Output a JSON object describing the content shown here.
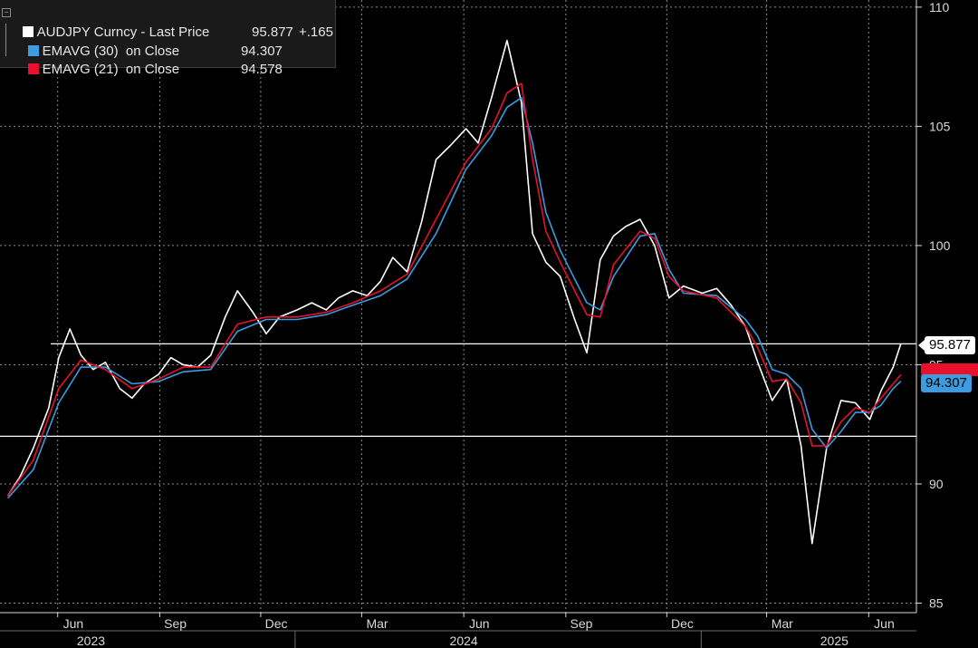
{
  "legend": {
    "row1": {
      "name": "AUDJPY Curncy - Last Price",
      "value": "95.877",
      "change": "+.165",
      "color": "#ffffff"
    },
    "row2": {
      "name": "EMAVG (30)  on Close",
      "value": "94.307",
      "color": "#3d9be0"
    },
    "row3": {
      "name": "EMAVG (21)  on Close",
      "value": "94.578",
      "color": "#e8102a"
    }
  },
  "tags": {
    "last": "95.877",
    "ema30": "94.307"
  },
  "chart_data": {
    "type": "line",
    "title": "",
    "xlabel": "",
    "ylabel": "",
    "ylim": [
      84.6,
      110.3
    ],
    "yticks": [
      85,
      90,
      95,
      100,
      105,
      110
    ],
    "month_ticks": [
      {
        "label": "Jun",
        "month": "2023-06"
      },
      {
        "label": "Sep",
        "month": "2023-09"
      },
      {
        "label": "Dec",
        "month": "2023-12"
      },
      {
        "label": "Mar",
        "month": "2024-03"
      },
      {
        "label": "Jun",
        "month": "2024-06"
      },
      {
        "label": "Sep",
        "month": "2024-09"
      },
      {
        "label": "Dec",
        "month": "2024-12"
      },
      {
        "label": "Mar",
        "month": "2025-03"
      },
      {
        "label": "Jun",
        "month": "2025-06"
      }
    ],
    "year_labels": [
      {
        "label": "2023",
        "month": "2023-07"
      },
      {
        "label": "2024",
        "month": "2024-06"
      },
      {
        "label": "2025",
        "month": "2025-05"
      }
    ],
    "horizontal_lines": [
      95.877,
      92.0
    ],
    "colors": {
      "price": "#ffffff",
      "ema30": "#3d9be0",
      "ema21": "#e8102a",
      "grid": "#8c8c8c",
      "background": "#000000"
    },
    "series": [
      {
        "key": "price",
        "name": "AUDJPY Curncy - Last Price",
        "x": [
          "2023-04-17",
          "2023-04-28",
          "2023-05-10",
          "2023-05-24",
          "2023-06-02",
          "2023-06-12",
          "2023-06-22",
          "2023-07-03",
          "2023-07-14",
          "2023-07-27",
          "2023-08-07",
          "2023-08-18",
          "2023-08-31",
          "2023-09-11",
          "2023-09-22",
          "2023-10-05",
          "2023-10-17",
          "2023-10-30",
          "2023-11-10",
          "2023-11-24",
          "2023-12-06",
          "2023-12-18",
          "2024-01-03",
          "2024-01-16",
          "2024-01-29",
          "2024-02-09",
          "2024-02-22",
          "2024-03-06",
          "2024-03-18",
          "2024-03-29",
          "2024-04-11",
          "2024-04-24",
          "2024-05-07",
          "2024-05-20",
          "2024-06-03",
          "2024-06-14",
          "2024-06-26",
          "2024-07-10",
          "2024-07-23",
          "2024-08-02",
          "2024-08-14",
          "2024-08-27",
          "2024-09-09",
          "2024-09-20",
          "2024-10-02",
          "2024-10-14",
          "2024-10-25",
          "2024-11-07",
          "2024-11-20",
          "2024-12-03",
          "2024-12-16",
          "2025-01-02",
          "2025-01-15",
          "2025-01-28",
          "2025-02-10",
          "2025-02-21",
          "2025-03-06",
          "2025-03-19",
          "2025-04-01",
          "2025-04-11",
          "2025-04-24",
          "2025-05-07",
          "2025-05-20",
          "2025-06-02",
          "2025-06-12",
          "2025-06-23",
          "2025-06-30"
        ],
        "values": [
          89.5,
          90.3,
          91.5,
          93.2,
          95.3,
          96.5,
          95.4,
          94.8,
          95.1,
          94.0,
          93.6,
          94.2,
          94.6,
          95.3,
          95.0,
          94.9,
          95.4,
          97.0,
          98.1,
          97.2,
          96.3,
          97.0,
          97.3,
          97.6,
          97.3,
          97.8,
          98.1,
          97.9,
          98.5,
          99.5,
          98.9,
          101.0,
          103.6,
          104.2,
          104.9,
          104.3,
          106.2,
          108.6,
          106.0,
          100.5,
          99.3,
          98.7,
          96.9,
          95.5,
          99.4,
          100.4,
          100.8,
          101.1,
          100.0,
          97.8,
          98.3,
          98.0,
          98.2,
          97.5,
          96.6,
          95.1,
          93.5,
          94.4,
          91.6,
          87.5,
          91.5,
          93.5,
          93.4,
          92.7,
          93.9,
          94.9,
          95.877
        ]
      },
      {
        "key": "ema30",
        "name": "EMAVG (30)  on Close",
        "x": [
          "2023-04-17",
          "2023-05-10",
          "2023-06-02",
          "2023-06-22",
          "2023-07-14",
          "2023-08-07",
          "2023-08-31",
          "2023-09-22",
          "2023-10-17",
          "2023-11-10",
          "2023-12-06",
          "2024-01-03",
          "2024-01-29",
          "2024-02-22",
          "2024-03-18",
          "2024-04-11",
          "2024-05-07",
          "2024-06-03",
          "2024-06-26",
          "2024-07-10",
          "2024-07-23",
          "2024-08-02",
          "2024-08-14",
          "2024-08-27",
          "2024-09-09",
          "2024-09-20",
          "2024-10-02",
          "2024-10-14",
          "2024-11-07",
          "2024-11-20",
          "2024-12-03",
          "2024-12-16",
          "2025-01-15",
          "2025-02-10",
          "2025-02-21",
          "2025-03-06",
          "2025-03-19",
          "2025-04-01",
          "2025-04-11",
          "2025-04-24",
          "2025-05-07",
          "2025-05-20",
          "2025-06-02",
          "2025-06-12",
          "2025-06-23",
          "2025-06-30"
        ],
        "values": [
          89.4,
          90.6,
          93.4,
          94.9,
          94.9,
          94.2,
          94.3,
          94.7,
          94.8,
          96.4,
          96.9,
          96.9,
          97.1,
          97.5,
          97.9,
          98.6,
          100.5,
          103.2,
          104.6,
          105.8,
          106.2,
          104.3,
          101.4,
          99.8,
          98.6,
          97.6,
          97.3,
          98.7,
          100.4,
          100.5,
          99.0,
          98.0,
          97.9,
          96.9,
          96.2,
          94.8,
          94.6,
          94.0,
          92.3,
          91.5,
          92.2,
          93.0,
          93.0,
          93.3,
          94.0,
          94.307
        ]
      },
      {
        "key": "ema21",
        "name": "EMAVG (21)  on Close",
        "x": [
          "2023-04-17",
          "2023-05-10",
          "2023-06-02",
          "2023-06-22",
          "2023-07-14",
          "2023-08-07",
          "2023-08-31",
          "2023-09-22",
          "2023-10-17",
          "2023-11-10",
          "2023-12-06",
          "2024-01-03",
          "2024-01-29",
          "2024-02-22",
          "2024-03-18",
          "2024-04-11",
          "2024-05-07",
          "2024-06-03",
          "2024-06-26",
          "2024-07-10",
          "2024-07-23",
          "2024-08-02",
          "2024-08-14",
          "2024-08-27",
          "2024-09-09",
          "2024-09-20",
          "2024-10-02",
          "2024-10-14",
          "2024-11-07",
          "2024-11-20",
          "2024-12-03",
          "2024-12-16",
          "2025-01-15",
          "2025-02-10",
          "2025-02-21",
          "2025-03-06",
          "2025-03-19",
          "2025-04-01",
          "2025-04-11",
          "2025-04-24",
          "2025-05-07",
          "2025-05-20",
          "2025-06-02",
          "2025-06-12",
          "2025-06-23",
          "2025-06-30"
        ],
        "values": [
          89.5,
          91.0,
          94.0,
          95.2,
          94.8,
          94.0,
          94.4,
          94.9,
          94.9,
          96.7,
          97.0,
          97.0,
          97.2,
          97.6,
          98.1,
          98.8,
          101.1,
          103.5,
          104.9,
          106.4,
          106.8,
          103.6,
          100.6,
          99.3,
          98.1,
          97.1,
          97.0,
          99.2,
          100.6,
          100.3,
          98.7,
          98.1,
          97.8,
          96.6,
          95.7,
          94.3,
          94.4,
          93.4,
          91.6,
          91.6,
          92.6,
          93.2,
          93.0,
          93.6,
          94.2,
          94.578
        ]
      }
    ]
  }
}
